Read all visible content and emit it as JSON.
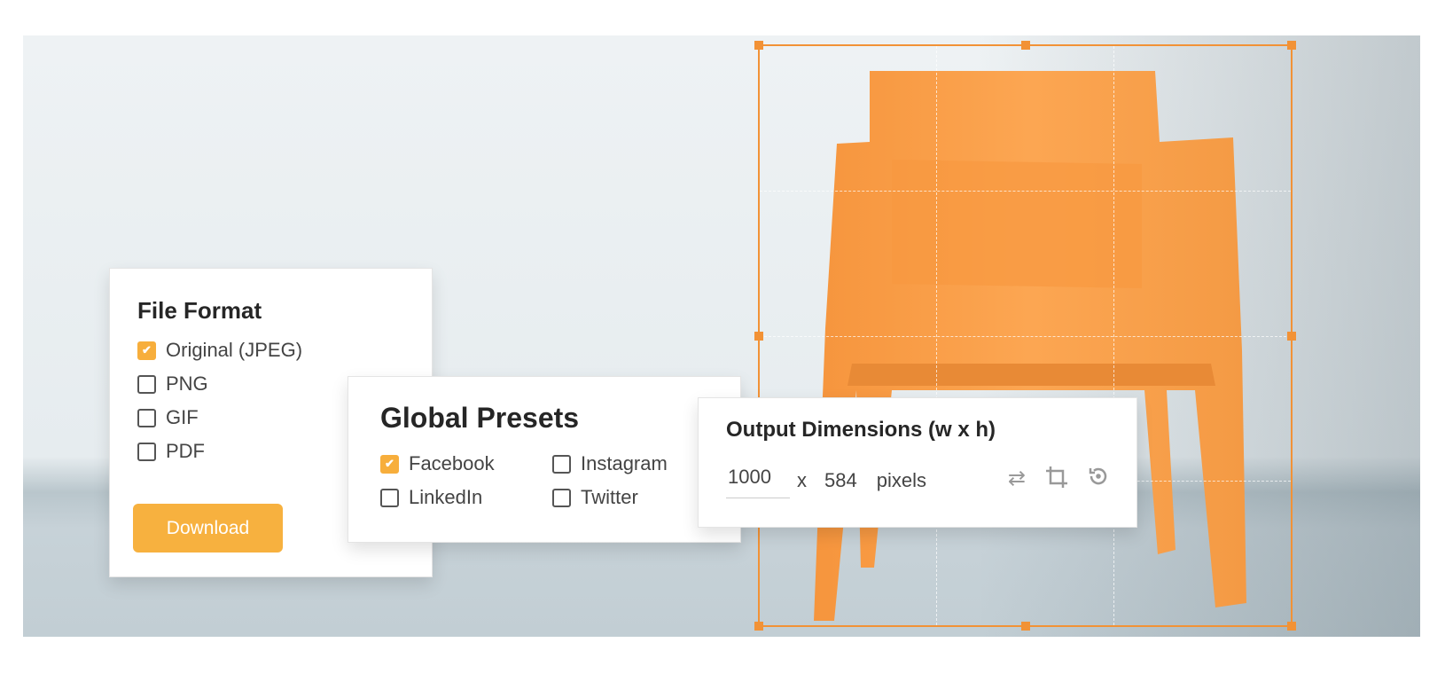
{
  "file_format": {
    "title": "File Format",
    "options": [
      {
        "label": "Original (JPEG)",
        "checked": true
      },
      {
        "label": "PNG",
        "checked": false
      },
      {
        "label": "GIF",
        "checked": false
      },
      {
        "label": "PDF",
        "checked": false
      }
    ],
    "download_label": "Download"
  },
  "global_presets": {
    "title": "Global Presets",
    "options": [
      {
        "label": "Facebook",
        "checked": true
      },
      {
        "label": "Instagram",
        "checked": false
      },
      {
        "label": "LinkedIn",
        "checked": false
      },
      {
        "label": "Twitter",
        "checked": false
      }
    ]
  },
  "output_dimensions": {
    "title": "Output Dimensions (w x h)",
    "width": "1000",
    "separator": "x",
    "height": "584",
    "unit": "pixels",
    "icons": [
      "swap-icon",
      "crop-icon",
      "reset-icon"
    ]
  },
  "colors": {
    "accent": "#f7ae3c",
    "crop_border": "#f29236",
    "chair": "#f7a04a"
  }
}
